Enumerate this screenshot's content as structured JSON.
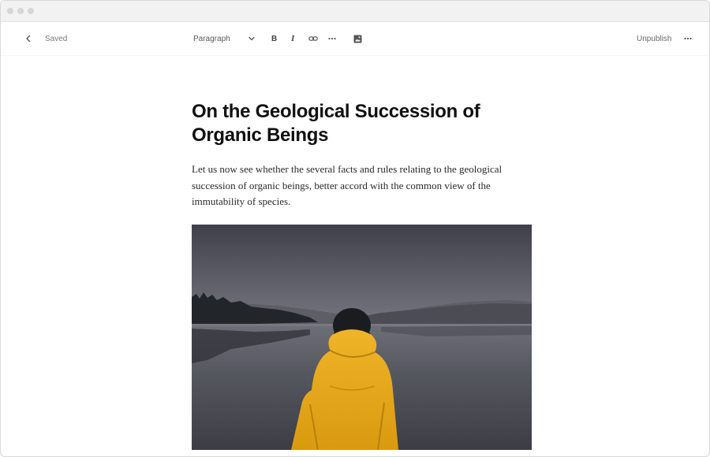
{
  "toolbar": {
    "back_icon": "chevron-left-icon",
    "saved_label": "Saved",
    "block_type": "Paragraph",
    "bold_label": "B",
    "italic_label": "I",
    "link_icon": "link-icon",
    "more_format_icon": "ellipsis-icon",
    "image_icon": "image-icon",
    "unpublish_label": "Unpublish",
    "menu_icon": "ellipsis-icon"
  },
  "post": {
    "title": "On the Geological Succession of Organic Beings",
    "body": "Let us now see whether the several facts and rules relating to the geological succession of organic beings, better accord with the common view of the immutability of species.",
    "image_subject": "person in yellow raincoat facing a misty lake"
  },
  "colors": {
    "titlebar": "#f2f2f2",
    "raincoat": "#e8a81c",
    "sky": "#4a4c55",
    "water": "#5d5f68"
  }
}
